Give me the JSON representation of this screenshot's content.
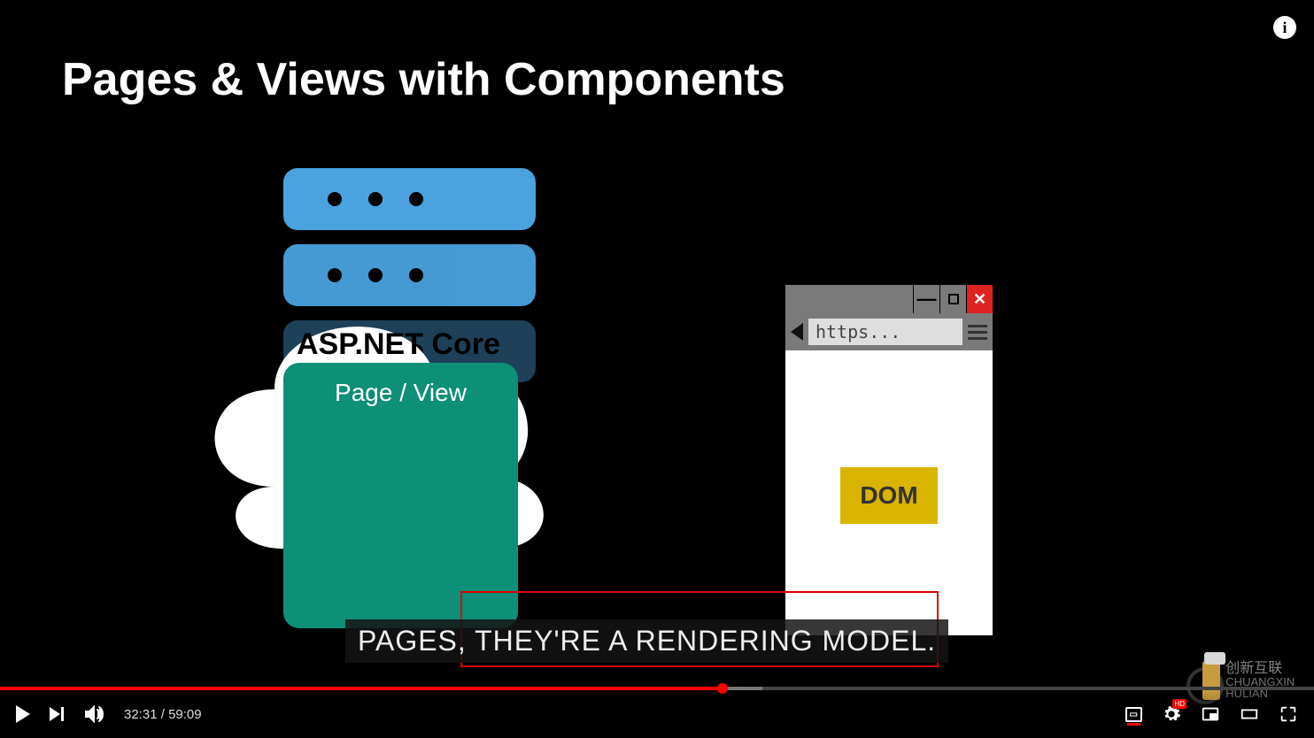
{
  "slide": {
    "title": "Pages & Views with Components",
    "cloud_label": "ASP.NET Core",
    "page_view_label": "Page / View",
    "browser": {
      "url_placeholder": "https...",
      "dom_label": "DOM"
    }
  },
  "caption": {
    "text": "PAGES, THEY'RE A RENDERING MODEL."
  },
  "player": {
    "current_time": "32:31",
    "duration": "59:09",
    "played_percent": 55,
    "cc_label": "CC",
    "hd_label": "HD",
    "info_label": "i"
  },
  "watermark": {
    "brand_cn": "创新互联",
    "brand_en": "CHUANGXIN HULIAN"
  }
}
